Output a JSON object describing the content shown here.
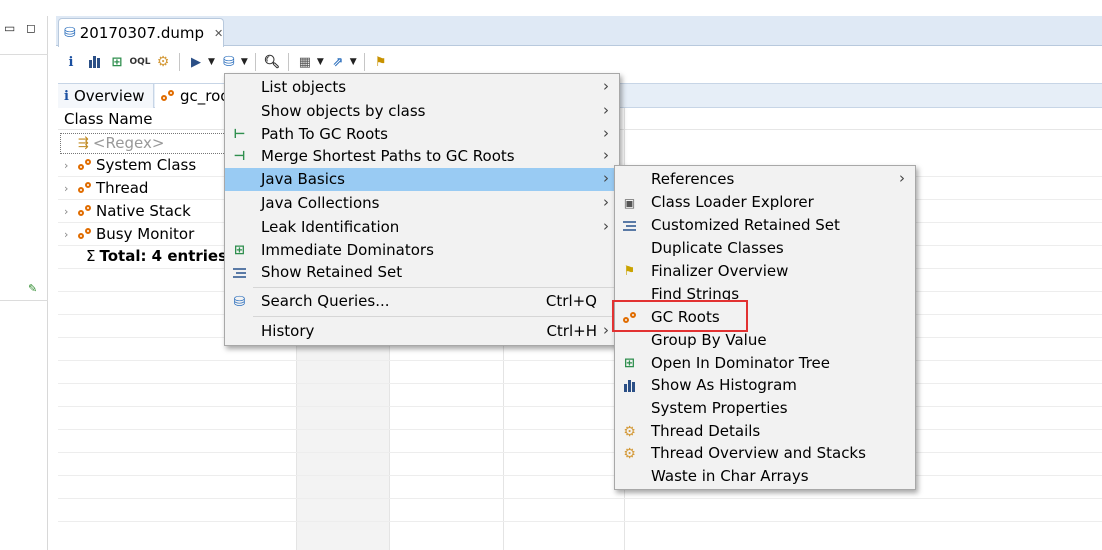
{
  "editor": {
    "tab_title": "20170307.dump"
  },
  "subtabs": [
    {
      "label": "Overview"
    },
    {
      "label": "gc_roo"
    }
  ],
  "table": {
    "column_header": "Class Name",
    "filter_placeholder": "<Regex>",
    "rows": [
      {
        "label": "System Class"
      },
      {
        "label": "Thread"
      },
      {
        "label": "Native Stack"
      },
      {
        "label": "Busy Monitor"
      }
    ],
    "total": "Total: 4 entries",
    "total_symbol": "Σ"
  },
  "menu": {
    "items": [
      {
        "label": "List objects",
        "icon": "none",
        "submenu": true
      },
      {
        "label": "Show objects by class",
        "icon": "none",
        "submenu": true
      },
      {
        "label": "Path To GC Roots",
        "icon": "path-to-gc-roots-icon",
        "submenu": true
      },
      {
        "label": "Merge Shortest Paths to GC Roots",
        "icon": "merge-paths-icon",
        "submenu": true
      },
      {
        "label": "Java Basics",
        "icon": "none",
        "submenu": true,
        "highlighted": true
      },
      {
        "label": "Java Collections",
        "icon": "none",
        "submenu": true
      },
      {
        "label": "Leak Identification",
        "icon": "none",
        "submenu": true
      },
      {
        "label": "Immediate Dominators",
        "icon": "immediate-dominators-icon",
        "submenu": false
      },
      {
        "label": "Show Retained Set",
        "icon": "retained-set-icon",
        "submenu": false
      },
      {
        "label": "Search Queries...",
        "icon": "search-queries-icon",
        "shortcut": "Ctrl+Q",
        "submenu": false
      },
      {
        "label": "History",
        "icon": "none",
        "shortcut": "Ctrl+H",
        "submenu": true
      }
    ]
  },
  "submenu": {
    "items": [
      {
        "label": "References",
        "icon": "none",
        "submenu": true
      },
      {
        "label": "Class Loader Explorer",
        "icon": "class-loader-icon"
      },
      {
        "label": "Customized Retained Set",
        "icon": "retained-set-icon"
      },
      {
        "label": "Duplicate Classes",
        "icon": "none"
      },
      {
        "label": "Finalizer Overview",
        "icon": "finalizer-icon"
      },
      {
        "label": "Find Strings",
        "icon": "none"
      },
      {
        "label": "GC Roots",
        "icon": "gc-roots-icon",
        "boxed": true
      },
      {
        "label": "Group By Value",
        "icon": "none"
      },
      {
        "label": "Open In Dominator Tree",
        "icon": "dominator-tree-icon"
      },
      {
        "label": "Show As Histogram",
        "icon": "histogram-icon"
      },
      {
        "label": "System Properties",
        "icon": "none"
      },
      {
        "label": "Thread Details",
        "icon": "thread-gear-icon"
      },
      {
        "label": "Thread Overview and Stacks",
        "icon": "thread-gear-icon"
      },
      {
        "label": "Waste in Char Arrays",
        "icon": "none"
      }
    ]
  },
  "colors": {
    "highlight": "#99cbf3",
    "red_box": "#e23232",
    "tab_bar": "#dfe9f5"
  }
}
